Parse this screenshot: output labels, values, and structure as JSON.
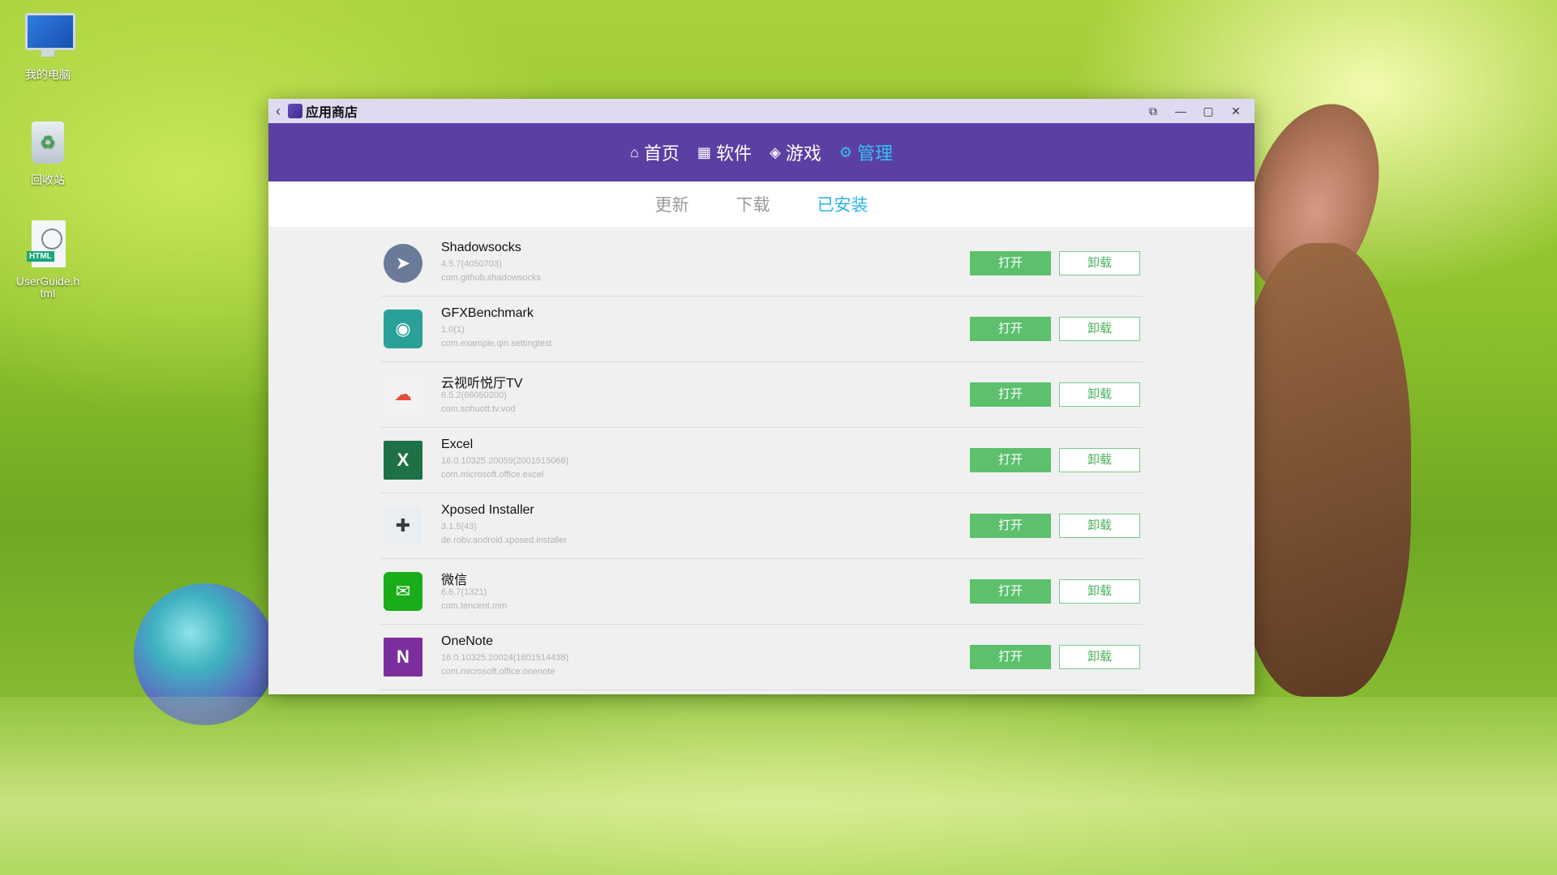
{
  "desktop": {
    "icons": [
      {
        "label": "我的电脑"
      },
      {
        "label": "回收站"
      },
      {
        "label": "UserGuide.html",
        "badge": "HTML"
      }
    ]
  },
  "window": {
    "title": "应用商店",
    "controls": {
      "back": "‹",
      "pin": "⧉",
      "minimize": "—",
      "maximize": "▢",
      "close": "✕"
    }
  },
  "topnav": {
    "items": [
      {
        "label": "首页",
        "icon": "home-icon",
        "glyph": "⌂"
      },
      {
        "label": "软件",
        "icon": "apps-grid-icon",
        "glyph": "▦"
      },
      {
        "label": "游戏",
        "icon": "gamepad-icon",
        "glyph": "◈"
      },
      {
        "label": "管理",
        "icon": "gear-icon",
        "glyph": "⚙"
      }
    ],
    "active": 3
  },
  "subtabs": {
    "items": [
      "更新",
      "下载",
      "已安装"
    ],
    "active": 2
  },
  "apps": [
    {
      "name": "Shadowsocks",
      "version": "4.5.7(4050703)",
      "package": "com.github.shadowsocks",
      "icon": "paper-plane-icon",
      "glyph": "➤",
      "color": "#6b7a99"
    },
    {
      "name": "GFXBenchmark",
      "version": "1.0(1)",
      "package": "com.example.qin.settingtest",
      "icon": "android-icon",
      "glyph": "◉",
      "color": "#2aa198"
    },
    {
      "name": "云视听悦厅TV",
      "version": "6.5.2(66050200)",
      "package": "com.sohuott.tv.vod",
      "icon": "cloud-play-icon",
      "glyph": "☁",
      "color": "#e84a3a"
    },
    {
      "name": "Excel",
      "version": "16.0.10325.20059(2001515068)",
      "package": "com.microsoft.office.excel",
      "icon": "excel-icon",
      "glyph": "X",
      "color": "#1e7145"
    },
    {
      "name": "Xposed Installer",
      "version": "3.1.5(43)",
      "package": "de.robv.android.xposed.installer",
      "icon": "puzzle-icon",
      "glyph": "✚",
      "color": "#3b3b3b"
    },
    {
      "name": "微信",
      "version": "6.6.7(1321)",
      "package": "com.tencent.mm",
      "icon": "wechat-icon",
      "glyph": "✉",
      "color": "#1aad19"
    },
    {
      "name": "OneNote",
      "version": "16.0.10325.20024(1801514438)",
      "package": "com.microsoft.office.onenote",
      "icon": "onenote-icon",
      "glyph": "N",
      "color": "#7b2f9e"
    }
  ],
  "buttons": {
    "open": "打开",
    "uninstall": "卸载"
  }
}
